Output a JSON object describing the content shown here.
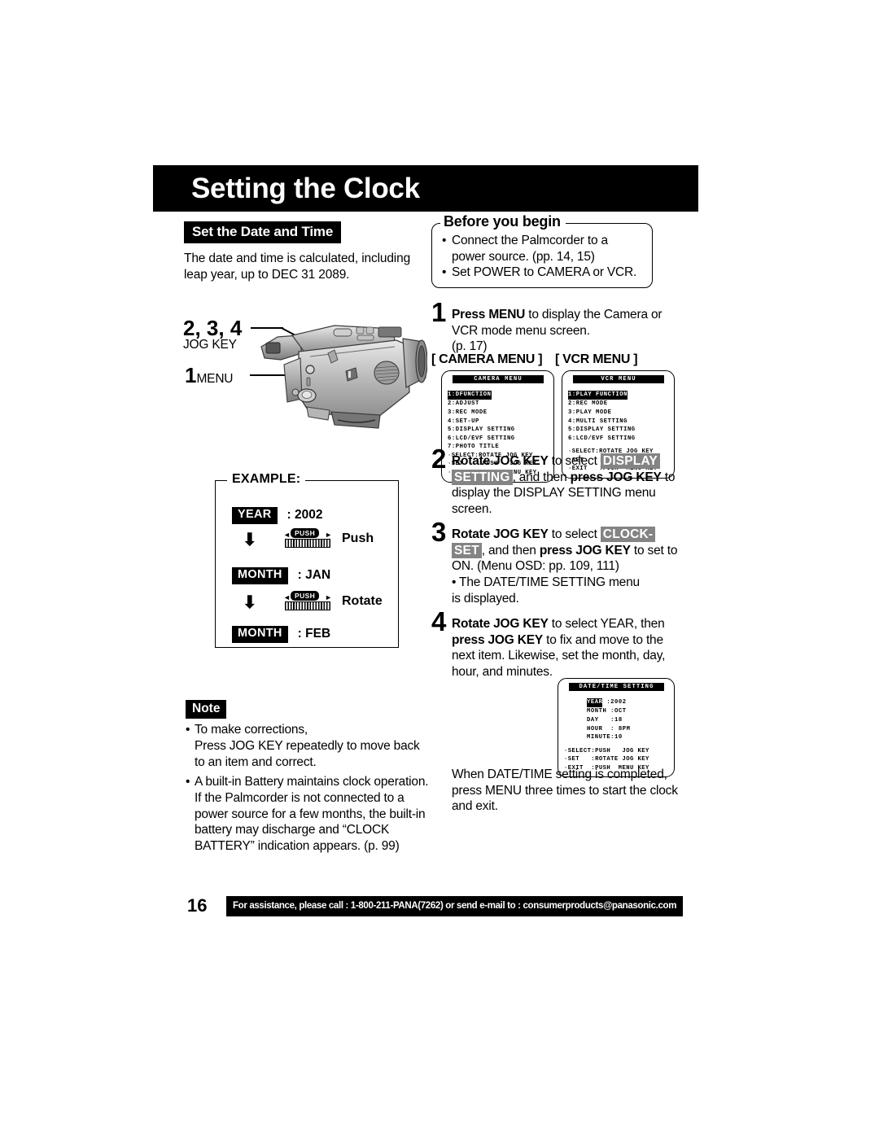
{
  "page_title": "Setting the Clock",
  "left": {
    "section_heading": "Set the Date and Time",
    "intro_text": "The date and time is calculated, including leap year, up to DEC 31 2089.",
    "callouts": {
      "jog_steps": "2, 3, 4",
      "jog_label": "JOG KEY",
      "menu_step": "1",
      "menu_label": "MENU"
    },
    "example": {
      "label": "EXAMPLE:",
      "row1_chip": "YEAR",
      "row1_value": ": 2002",
      "action1": "Push",
      "row2_chip": "MONTH",
      "row2_value": ": JAN",
      "action2": "Rotate",
      "row3_chip": "MONTH",
      "row3_value": ": FEB",
      "jog_push_label": "PUSH",
      "arrow_glyph": "⬇"
    },
    "note": {
      "label": "Note",
      "bullet": "•",
      "items": [
        "To make corrections,\n   Press JOG KEY repeatedly to move back\n   to an item and correct.",
        "A built-in Battery maintains clock operation. If the Palmcorder is not connected to a power source for a few months, the built-in battery may discharge and “CLOCK BATTERY” indication appears. (p. 99)"
      ]
    }
  },
  "right": {
    "before_you_begin": {
      "title": "Before you begin",
      "bullet": "•",
      "items": [
        "Connect the Palmcorder to a power source. (pp. 14, 15)",
        "Set POWER to CAMERA or VCR."
      ]
    },
    "steps": [
      {
        "num": "1",
        "parts": [
          {
            "t": "Press MENU",
            "b": true
          },
          {
            "t": " to display the Camera or VCR mode menu screen.",
            "b": false
          },
          {
            "t": "\n(p. 17)",
            "b": false
          }
        ]
      },
      {
        "num": "2",
        "parts": [
          {
            "t": "Rotate JOG KEY",
            "b": true
          },
          {
            "t": " to select ",
            "b": false
          },
          {
            "t": "DISPLAY",
            "hl": true
          },
          {
            "t": " ",
            "b": false
          },
          {
            "t": "SETTING",
            "hl": true
          },
          {
            "t": ", and then ",
            "b": false
          },
          {
            "t": "press JOG KEY",
            "b": true
          },
          {
            "t": " to display the DISPLAY SETTING menu screen.",
            "b": false
          }
        ]
      },
      {
        "num": "3",
        "parts": [
          {
            "t": "Rotate JOG KEY",
            "b": true
          },
          {
            "t": " to select ",
            "b": false
          },
          {
            "t": "CLOCK-",
            "hl": true
          },
          {
            "t": " ",
            "b": false
          },
          {
            "t": "SET",
            "hl": true
          },
          {
            "t": ", and then ",
            "b": false
          },
          {
            "t": "press JOG KEY",
            "b": true
          },
          {
            "t": " to set to ON. (Menu OSD: pp. 109, 111)",
            "b": false
          },
          {
            "t": "\n• The DATE/TIME SETTING menu\n   is displayed.",
            "b": false
          }
        ]
      },
      {
        "num": "4",
        "parts": [
          {
            "t": "Rotate JOG KEY",
            "b": true
          },
          {
            "t": " to select YEAR, then ",
            "b": false
          },
          {
            "t": "press JOG KEY",
            "b": true
          },
          {
            "t": " to fix and move to the next item. Likewise, set the month, day, hour, and minutes.",
            "b": false
          }
        ]
      }
    ],
    "closing_text": "When DATE/TIME setting is completed, press MENU three times to start the clock and exit.",
    "menu_headers": {
      "camera": "[ CAMERA MENU ]",
      "vcr": "[ VCR MENU ]"
    },
    "osd_camera": {
      "title": "CAMERA  MENU",
      "selected": "1:DFUNCTION",
      "lines": [
        "2:ADJUST",
        "3:REC MODE",
        "4:SET-UP",
        "5:DISPLAY SETTING",
        "6:LCD/EVF SETTING",
        "7:PHOTO TITLE"
      ],
      "footer": [
        "·SELECT:ROTATE JOG KEY",
        "·SET    :PUSH   JOG KEY",
        "·EXIT   :PUSH  MENU KEY"
      ]
    },
    "osd_vcr": {
      "title": "VCR  MENU",
      "selected": "1:PLAY FUNCTION",
      "lines": [
        "2:REC MODE",
        "3:PLAY MODE",
        "4:MULTI SETTING",
        "5:DISPLAY SETTING",
        "6:LCD/EVF SETTING"
      ],
      "footer": [
        "·SELECT:ROTATE JOG KEY",
        "·SET    :PUSH   JOG KEY",
        "·EXIT   :PUSH  MENU KEY"
      ]
    },
    "osd_datetime": {
      "title": "DATE/TIME  SETTING",
      "selected": "YEAR",
      "selected_value": " :2002",
      "lines": [
        "MONTH :OCT",
        "DAY   :18",
        "HOUR  : 8PM",
        "MINUTE:10"
      ],
      "footer": [
        "·SELECT:PUSH   JOG KEY",
        "·SET   :ROTATE JOG KEY",
        "·EXIT  :PUSH  MENU KEY"
      ]
    }
  },
  "footer": {
    "page_number": "16",
    "assistance_text": "For assistance, please call : 1-800-211-PANA(7262) or send e-mail to : consumerproducts@panasonic.com"
  },
  "colors": {
    "ink": "#000000",
    "paper": "#ffffff",
    "highlight_gray": "#848484"
  }
}
